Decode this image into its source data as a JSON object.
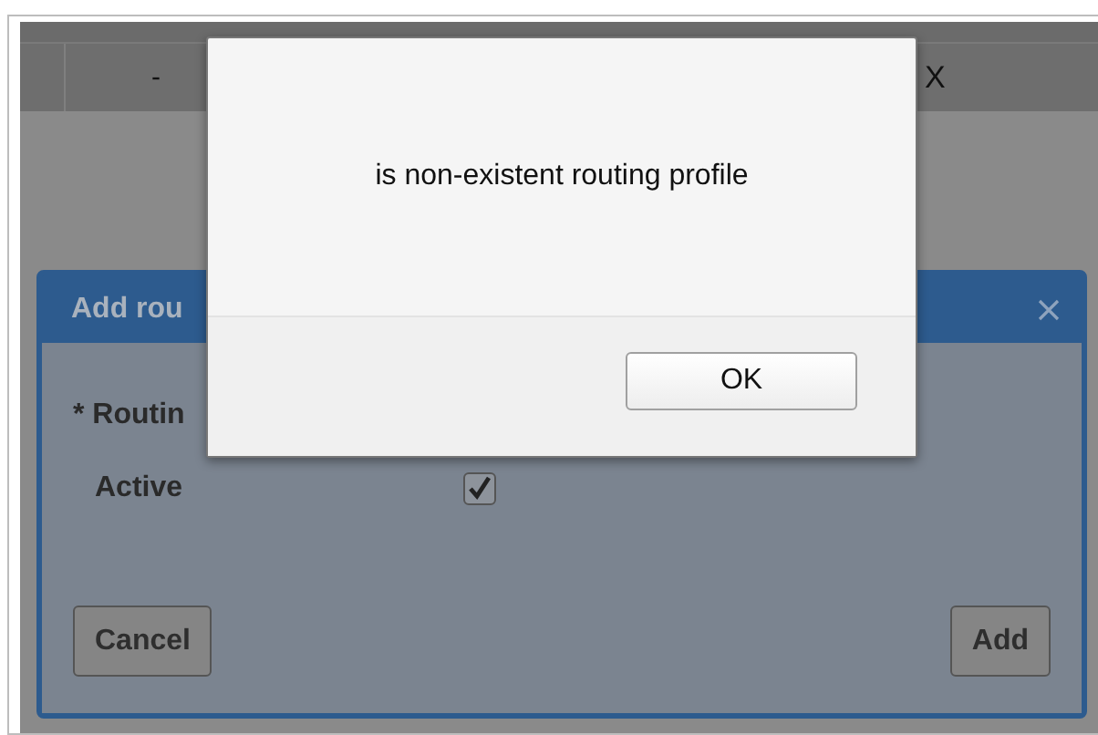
{
  "table_row": {
    "cells": [
      "-",
      "X"
    ]
  },
  "dialog": {
    "title": "Add rou",
    "fields": [
      {
        "kind": "text",
        "label": "* Routin"
      },
      {
        "kind": "checkbox",
        "label": "Active",
        "checked": true
      }
    ],
    "buttons": [
      "Cancel",
      "Add"
    ]
  },
  "alert": {
    "message": "is non-existent routing profile",
    "button": "OK"
  }
}
